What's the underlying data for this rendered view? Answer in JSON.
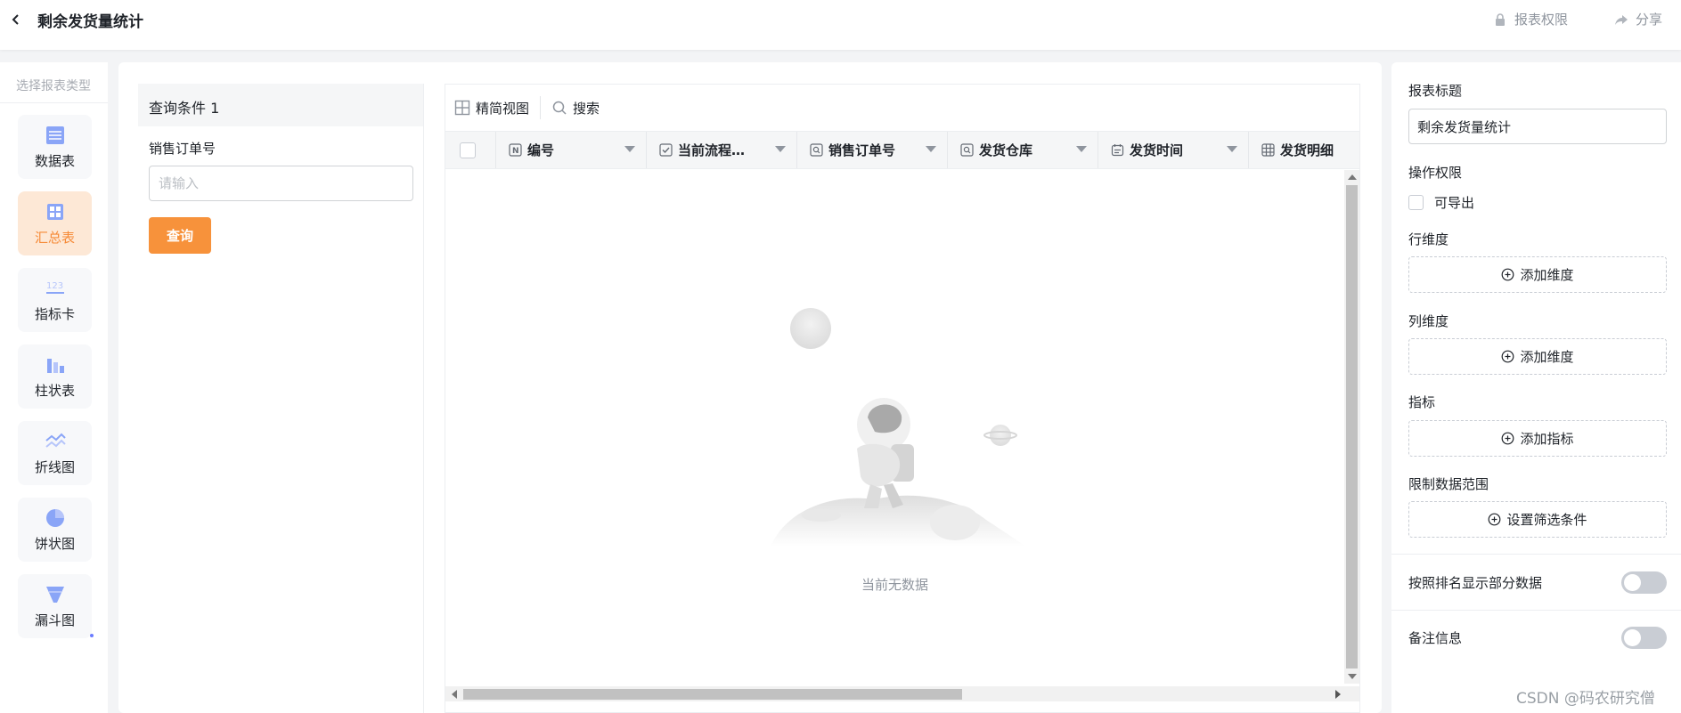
{
  "header": {
    "title": "剩余发货量统计",
    "permission_label": "报表权限",
    "share_label": "分享"
  },
  "type_panel": {
    "hint": "选择报表类型",
    "items": [
      {
        "label": "数据表",
        "icon": "table-icon",
        "active": false
      },
      {
        "label": "汇总表",
        "icon": "pivot-table-icon",
        "active": true
      },
      {
        "label": "指标卡",
        "icon": "metric-card-icon",
        "active": false
      },
      {
        "label": "柱状表",
        "icon": "bar-chart-icon",
        "active": false
      },
      {
        "label": "折线图",
        "icon": "line-chart-icon",
        "active": false
      },
      {
        "label": "饼状图",
        "icon": "pie-chart-icon",
        "active": false
      },
      {
        "label": "漏斗图",
        "icon": "funnel-chart-icon",
        "active": false
      }
    ]
  },
  "query": {
    "header": "查询条件 1",
    "field_label": "销售订单号",
    "placeholder": "请输入",
    "value": "",
    "button": "查询"
  },
  "table": {
    "toolbar": {
      "view_label": "精简视图",
      "search_label": "搜索"
    },
    "columns": [
      {
        "label": "编号",
        "icon": "number-field-icon"
      },
      {
        "label": "当前流程…",
        "icon": "checkbox-field-icon"
      },
      {
        "label": "销售订单号",
        "icon": "lookup-field-icon"
      },
      {
        "label": "发货仓库",
        "icon": "lookup-field-icon"
      },
      {
        "label": "发货时间",
        "icon": "calendar-icon"
      },
      {
        "label": "发货明细",
        "icon": "subtable-icon"
      }
    ],
    "empty_text": "当前无数据"
  },
  "settings": {
    "title_label": "报表标题",
    "title_value": "剩余发货量统计",
    "permission_label": "操作权限",
    "exportable_label": "可导出",
    "exportable_checked": false,
    "row_dim_label": "行维度",
    "row_dim_button": "添加维度",
    "col_dim_label": "列维度",
    "col_dim_button": "添加维度",
    "metric_label": "指标",
    "metric_button": "添加指标",
    "range_label": "限制数据范围",
    "range_button": "设置筛选条件",
    "rank_toggle_label": "按照排名显示部分数据",
    "rank_toggle_on": false,
    "note_toggle_label": "备注信息",
    "note_toggle_on": false
  },
  "watermark": "CSDN @码农研究僧",
  "colors": {
    "accent": "#f7923b",
    "active_bg": "#fde8d6",
    "icon_blue": "#7e9bf5"
  }
}
